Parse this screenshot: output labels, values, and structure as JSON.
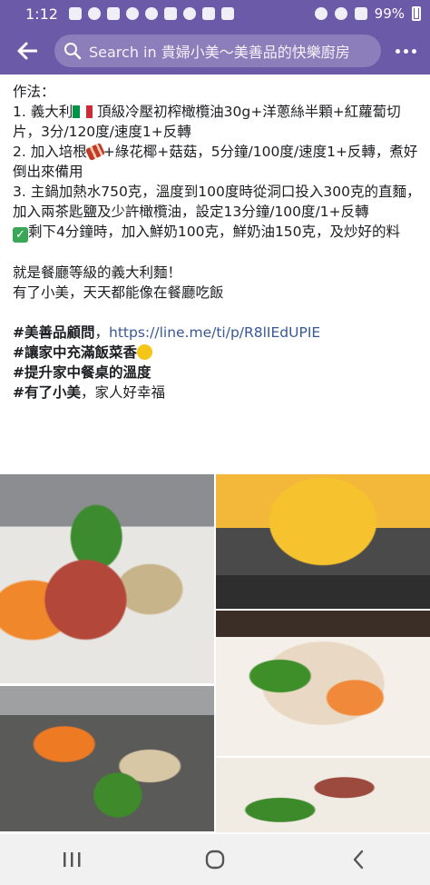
{
  "status_bar": {
    "time": "1:12",
    "battery": "99%"
  },
  "header": {
    "search_text": "Search in 貴婦小美～美善品的快樂廚房"
  },
  "post": {
    "lines": {
      "l0": "作法：",
      "l1a": "1. 義大利",
      "l1b": " 頂級冷壓初榨橄欖油30g+洋蔥絲半顆+紅蘿蔔切片，3分/120度/速度1+反轉",
      "l2a": "2. 加入培根",
      "l2b": "+綠花椰+菇菇，5分鐘/100度/速度1+反轉，煮好倒出來備用",
      "l3": "3. 主鍋加熱水750克，溫度到100度時從洞口投入300克的直麵，加入兩茶匙鹽及少許橄欖油，設定13分鐘/100度/1+反轉",
      "l4": "剩下4分鐘時，加入鮮奶100克，鮮奶油150克，及炒好的料",
      "l5": "就是餐廳等級的義大利麵！",
      "l6": "有了小美，天天都能像在餐廳吃飯",
      "tag1": "#美善品顧問",
      "tag1_sep": "，",
      "link": "https://line.me/ti/p/R8lIEdUPIE",
      "tag2": "#讓家中充滿飯菜香",
      "tag3": "#提升家中餐桌的溫度",
      "tag4": "#有了小美",
      "tag4_rest": "，家人好幸福"
    }
  },
  "photos": {
    "icon_names": [
      "photo-ingredients",
      "photo-pasta-pouring",
      "photo-pasta-dish",
      "photo-cooking-bowl",
      "photo-plated-pasta"
    ]
  },
  "colors": {
    "header": "#6b5aa8",
    "link": "#385898"
  }
}
